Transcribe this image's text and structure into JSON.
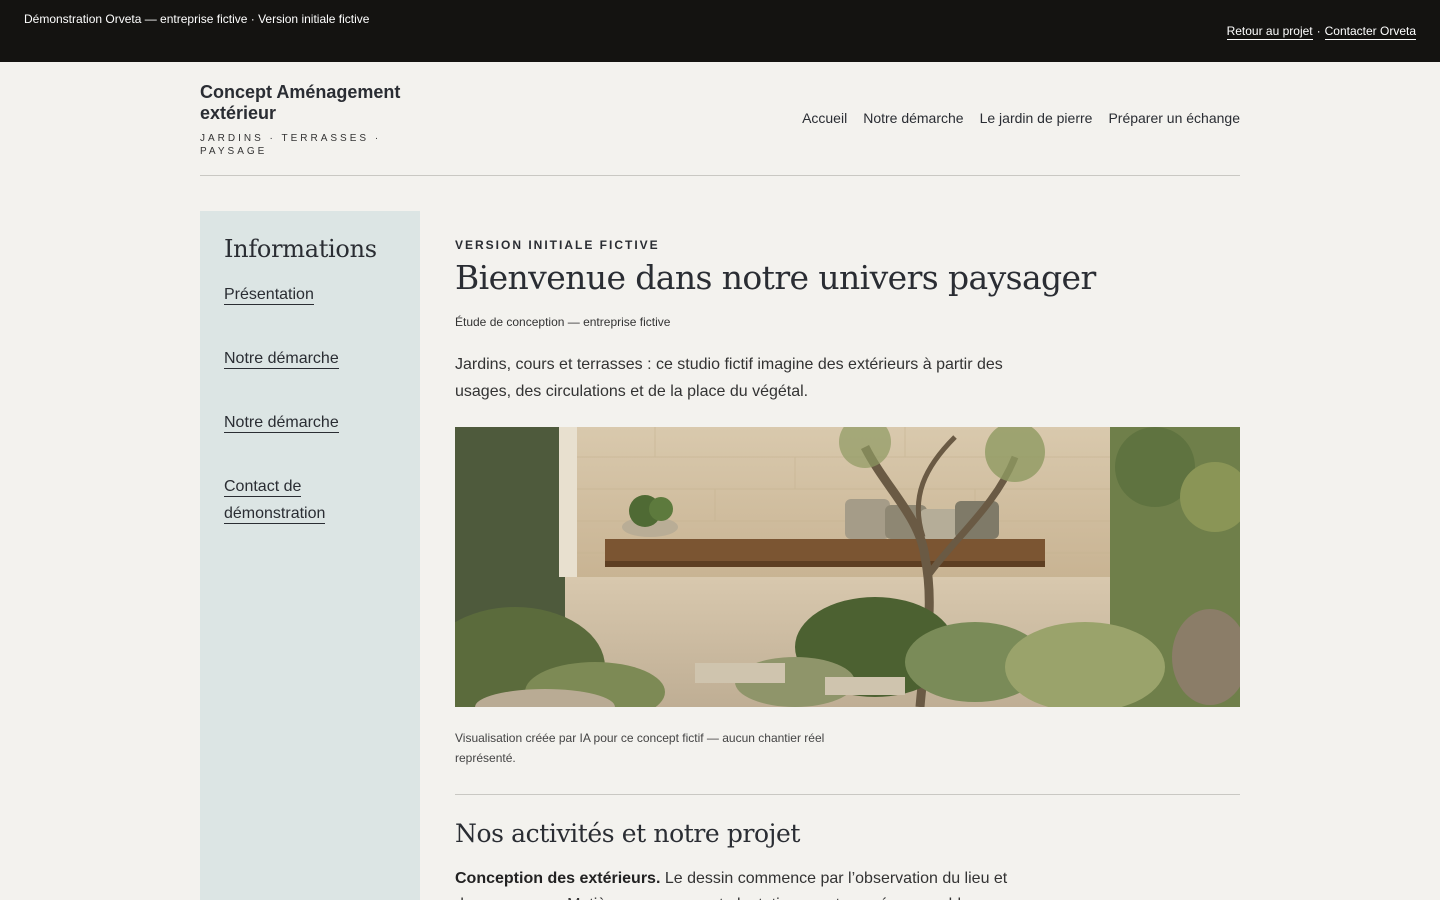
{
  "demo_bar": {
    "notice": "Démonstration Orveta — entreprise fictive · Version initiale fictive",
    "back_link": "Retour au projet",
    "separator": "·",
    "contact_link": "Contacter Orveta"
  },
  "header": {
    "brand_name": "Concept Aménagement extérieur",
    "brand_tagline": "JARDINS · TERRASSES · PAYSAGE",
    "nav": [
      "Accueil",
      "Notre démarche",
      "Le jardin de pierre",
      "Préparer un échange"
    ]
  },
  "sidebar": {
    "title": "Informations",
    "items": [
      "Présentation",
      "Notre démarche",
      "Notre démarche",
      "Contact de démonstration"
    ]
  },
  "main": {
    "eyebrow": "VERSION INITIALE FICTIVE",
    "title": "Bienvenue dans notre univers paysager",
    "subtitle": "Étude de conception — entreprise fictive",
    "intro": "Jardins, cours et terrasses : ce studio fictif imagine des extérieurs à partir des usages, des circulations et de la place du végétal.",
    "caption": "Visualisation créée par IA pour ce concept fictif — aucun chantier réel représenté.",
    "section_title": "Nos activités et notre projet",
    "section_lead": "Conception des extérieurs.",
    "section_text": " Le dessin commence par l’observation du lieu et de ses usages. Matières, passages et plantations sont pensés ensemble."
  },
  "colors": {
    "page_bg": "#f3f2ee",
    "demo_bar_bg": "#141311",
    "sidebar_bg": "#dce5e4",
    "text_dark": "#2a2d33"
  }
}
